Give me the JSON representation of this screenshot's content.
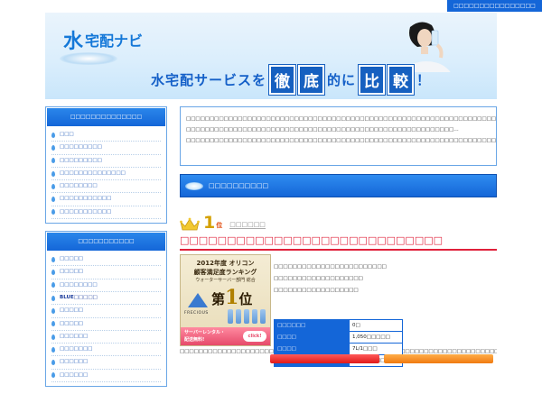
{
  "topbar": {
    "text": "□□□□□□□□□□□□□□□□"
  },
  "header": {
    "logo_mizu": "水",
    "logo_rest": "宅配ナビ",
    "slogan": {
      "part1": "水宅配サービスを",
      "box1": "徹",
      "box2": "底",
      "part2": "的に",
      "box3": "比",
      "box4": "較",
      "excl": "！"
    }
  },
  "sidebar": {
    "box1": {
      "title": "□□□□□□□□□□□□□□",
      "items": [
        "□□□",
        "□□□□□□□□□",
        "□□□□□□□□□",
        "□□□□□□□□□□□□□□",
        "□□□□□□□□",
        "□□□□□□□□□□□",
        "□□□□□□□□□□□"
      ]
    },
    "box2": {
      "title": "□□□□□□□□□□□",
      "items": [
        "□□□□□",
        "□□□□□",
        "□□□□□□□□",
        "BLUE□□□□□",
        "□□□□□",
        "□□□□□",
        "□□□□□□",
        "□□□□□□□",
        "□□□□□□",
        "□□□□□□"
      ]
    }
  },
  "main": {
    "intro": "□□□□□□□□□□□□□□□□□□□□□□□□□□□□□□□□□□□□□□□□□□□□□□□□□□□□□□□□□□□□□□□□□□□□□□□□□□□□□□□□□□□□□□□□□□□□□□□□□□□□□□□□□□□□□□□□□□□□□□□□□□□□□□□□□□□□□□□□□□□□□□□□□ □□□□□□□□□□□□□□□□□□□□□□□□□□□□□□□□□□□□□□□□□□□□□□□□□□□□□□□□□…□□□□□□□□□□□□□□□□□□□□□□□□□□□□□□□□□□□□□□□□□□□□□□□□□□□□□□□□□□□□□□□□□□□□□□□□□□□□□□□□□",
    "section_title": "□□□□□□□□□□",
    "rank_num": "1",
    "rank_suffix": "位",
    "rank_name": "□□□□□□",
    "product_title": "□□□□□□□□□□□□□□□□□□□□□□□□□□□□",
    "banner": {
      "line1": "2012年度 オリコン",
      "line2": "顧客満足度ランキング",
      "line3": "ウォーターサーバー部門 総合",
      "first": "第",
      "first_num": "1",
      "first_suffix": "位",
      "brand": "FRECIOUS",
      "free1": "サーバーレンタル・",
      "free2": "配送無料!",
      "click": "click!"
    },
    "features": [
      "□□□□□□□□□□□□□□□□□□□□□□□□",
      "□□□□□□□□□□□□□□□□□□□",
      "□□□□□□□□□□□□□□□□□□"
    ],
    "spec": [
      {
        "k": "□□□□□□",
        "v": "0□"
      },
      {
        "k": "□□□□",
        "v": "1,050□□□□□"
      },
      {
        "k": "□□□□",
        "v": "7L/1□□□"
      },
      {
        "k": "□□□□",
        "v": "□□□□□□□□□□"
      }
    ],
    "desc": "□□□□□□□□□□□□□□□□□□□□□□□□□□□□□□□□□□□□□□□□□□□□□□□□□□□□□□□□□□□□□□□□□□□□□□□□□□□□□□□□□□□□□□□□□□□□□□□□□□□□□□□□□□□□□□□□□□□□□□□□□□□□□□□□□□□□□□□□□□□□□□□□□□□□□□□□□□□□□□□□□□□□□□□□□□□□□□□□□□□□□□□□□□□□□□□□□□□□□□□□□"
  }
}
